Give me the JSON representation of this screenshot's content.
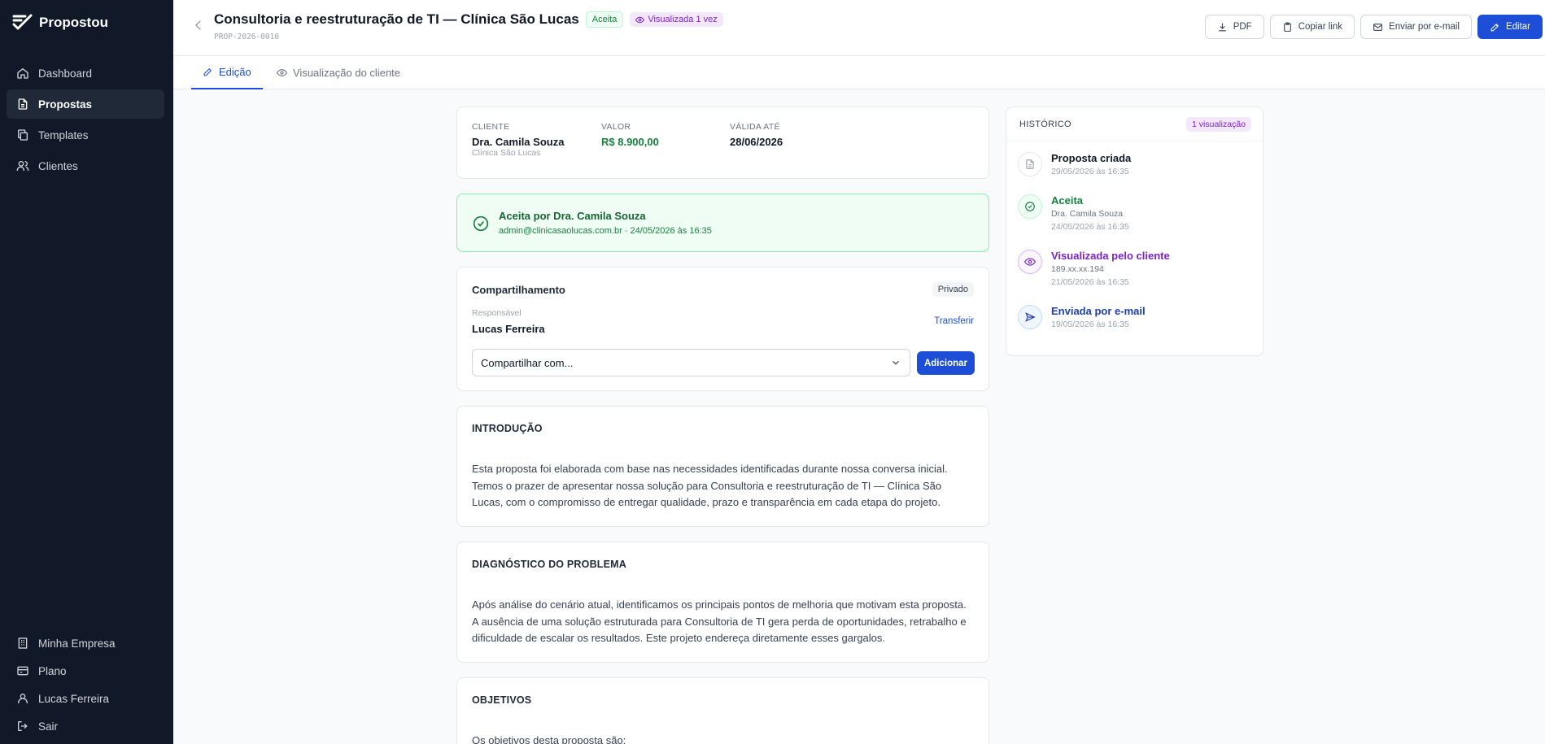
{
  "app": {
    "name": "Propostou"
  },
  "sidebar": {
    "items": [
      {
        "label": "Dashboard",
        "icon": "home-icon"
      },
      {
        "label": "Propostas",
        "icon": "document-icon",
        "active": true
      },
      {
        "label": "Templates",
        "icon": "copy-icon"
      },
      {
        "label": "Clientes",
        "icon": "users-icon"
      }
    ],
    "bottom": [
      {
        "label": "Minha Empresa",
        "icon": "building-icon"
      },
      {
        "label": "Plano",
        "icon": "credit-card-icon"
      },
      {
        "label": "Lucas Ferreira",
        "icon": "user-icon"
      },
      {
        "label": "Sair",
        "icon": "logout-icon"
      }
    ]
  },
  "header": {
    "title": "Consultoria e reestruturação de TI — Clínica São Lucas",
    "status_badge": "Aceita",
    "views_badge": "Visualizada 1 vez",
    "code": "PROP-2026-0010",
    "actions": {
      "pdf": "PDF",
      "copy_link": "Copiar link",
      "email": "Enviar por e-mail",
      "edit": "Editar"
    }
  },
  "tabs": [
    {
      "label": "Edição",
      "active": true
    },
    {
      "label": "Visualização do cliente"
    }
  ],
  "summary": {
    "client_label": "CLIENTE",
    "client_name": "Dra. Camila Souza",
    "client_company": "Clínica São Lucas",
    "value_label": "VALOR",
    "value": "R$ 8.900,00",
    "valid_label": "VÁLIDA ATÉ",
    "valid_until": "28/06/2026"
  },
  "acceptance": {
    "title": "Aceita por Dra. Camila Souza",
    "subtitle": "admin@clinicasaolucas.com.br · 24/05/2026 às 16:35"
  },
  "sharing": {
    "title": "Compartilhamento",
    "privacy": "Privado",
    "owner_label": "Responsável",
    "owner": "Lucas Ferreira",
    "transfer": "Transferir",
    "select_value": "Compartilhar com...",
    "add": "Adicionar"
  },
  "sections": [
    {
      "title": "INTRODUÇÃO",
      "body": "Esta proposta foi elaborada com base nas necessidades identificadas durante nossa conversa inicial. Temos o prazer de apresentar nossa solução para Consultoria e reestruturação de TI — Clínica São Lucas, com o compromisso de entregar qualidade, prazo e transparência em cada etapa do projeto."
    },
    {
      "title": "DIAGNÓSTICO DO PROBLEMA",
      "body": "Após análise do cenário atual, identificamos os principais pontos de melhoria que motivam esta proposta. A ausência de uma solução estruturada para Consultoria de TI gera perda de oportunidades, retrabalho e dificuldade de escalar os resultados. Este projeto endereça diretamente esses gargalos."
    },
    {
      "title": "OBJETIVOS",
      "body": "Os objetivos desta proposta são:"
    }
  ],
  "history": {
    "title": "HISTÓRICO",
    "badge": "1 visualização",
    "events": [
      {
        "title": "Proposta criada",
        "line2": "29/05/2026 às 16:35",
        "line3": "",
        "icon": "file-icon",
        "color": "#111827"
      },
      {
        "title": "Aceita",
        "line2": "Dra. Camila Souza",
        "line3": "24/05/2026 às 16:35",
        "icon": "check-circle-icon",
        "color": "#15803d"
      },
      {
        "title": "Visualizada pelo cliente",
        "line2": "189.xx.xx.194",
        "line3": "21/05/2026 às 16:35",
        "icon": "eye-icon",
        "color": "#7e22ce"
      },
      {
        "title": "Enviada por e-mail",
        "line2": "19/05/2026 às 16:35",
        "line3": "",
        "icon": "send-icon",
        "color": "#1e40af"
      }
    ]
  },
  "colors": {
    "primary": "#1d4ed8",
    "sidebar": "#111827",
    "success": "#15803d",
    "purple": "#7e22ce"
  }
}
